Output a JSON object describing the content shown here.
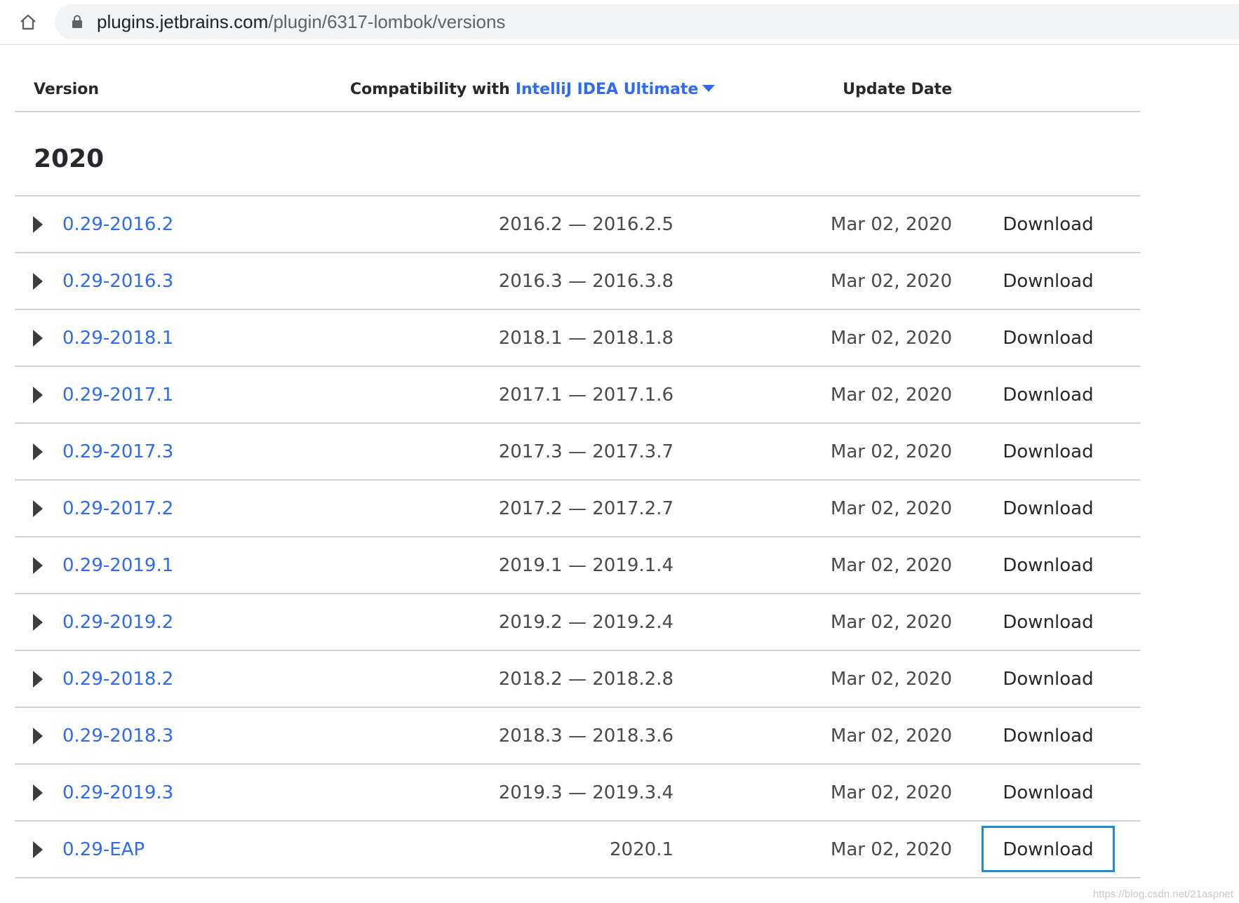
{
  "browser": {
    "url_host": "plugins.jetbrains.com",
    "url_path": "/plugin/6317-lombok/versions"
  },
  "table": {
    "headers": {
      "version": "Version",
      "compat_prefix": "Compatibility with",
      "compat_ide": "IntelliJ IDEA Ultimate",
      "update_date": "Update Date"
    },
    "year": "2020",
    "rows": [
      {
        "version": "0.29-2016.2",
        "compat": "2016.2 — 2016.2.5",
        "date": "Mar 02, 2020",
        "download": "Download"
      },
      {
        "version": "0.29-2016.3",
        "compat": "2016.3 — 2016.3.8",
        "date": "Mar 02, 2020",
        "download": "Download"
      },
      {
        "version": "0.29-2018.1",
        "compat": "2018.1 — 2018.1.8",
        "date": "Mar 02, 2020",
        "download": "Download"
      },
      {
        "version": "0.29-2017.1",
        "compat": "2017.1 — 2017.1.6",
        "date": "Mar 02, 2020",
        "download": "Download"
      },
      {
        "version": "0.29-2017.3",
        "compat": "2017.3 — 2017.3.7",
        "date": "Mar 02, 2020",
        "download": "Download"
      },
      {
        "version": "0.29-2017.2",
        "compat": "2017.2 — 2017.2.7",
        "date": "Mar 02, 2020",
        "download": "Download"
      },
      {
        "version": "0.29-2019.1",
        "compat": "2019.1 — 2019.1.4",
        "date": "Mar 02, 2020",
        "download": "Download"
      },
      {
        "version": "0.29-2019.2",
        "compat": "2019.2 — 2019.2.4",
        "date": "Mar 02, 2020",
        "download": "Download"
      },
      {
        "version": "0.29-2018.2",
        "compat": "2018.2 — 2018.2.8",
        "date": "Mar 02, 2020",
        "download": "Download"
      },
      {
        "version": "0.29-2018.3",
        "compat": "2018.3 — 2018.3.6",
        "date": "Mar 02, 2020",
        "download": "Download"
      },
      {
        "version": "0.29-2019.3",
        "compat": "2019.3 — 2019.3.4",
        "date": "Mar 02, 2020",
        "download": "Download"
      },
      {
        "version": "0.29-EAP",
        "compat": "2020.1",
        "date": "Mar 02, 2020",
        "download": "Download"
      }
    ]
  },
  "watermark": "https://blog.csdn.net/21aspnet",
  "icons": {
    "home": "home-icon",
    "lock": "lock-icon",
    "expand": "triangle-right-icon",
    "dropdown": "caret-down-icon"
  },
  "colors": {
    "link": "#2e6af5",
    "focus_ring": "#1e8bd6"
  }
}
